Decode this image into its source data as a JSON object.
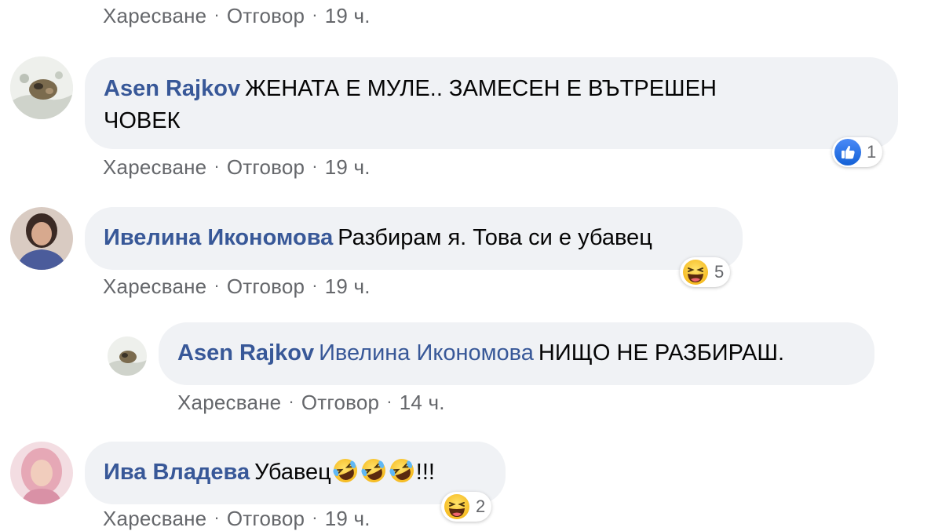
{
  "actions": {
    "like": "Харесване",
    "reply": "Отговор"
  },
  "comments": [
    {
      "time": "19 ч."
    },
    {
      "author": "Asen Rajkov",
      "line1": "ЖЕНАТА Е МУЛЕ.. ЗАМЕСЕН Е ВЪТРЕШЕН",
      "line2": "ЧОВЕК",
      "time": "19 ч.",
      "reaction": {
        "icon": "thumbs-up-icon",
        "count": "1"
      }
    },
    {
      "author": "Ивелина Икономова",
      "text": "Разбирам я. Това си е убавец",
      "time": "19 ч.",
      "reaction": {
        "icon": "laughing-emoji-icon",
        "count": "5"
      }
    },
    {
      "author": "Asen Rajkov",
      "mention": "Ивелина Икономова",
      "text": "НИЩО НЕ РАЗБИРАШ.",
      "time": "14 ч."
    },
    {
      "author": "Ива Владева",
      "text_before": "Убавец",
      "text_after": "!!!",
      "inline_emoji": [
        "rolling-laughing-emoji-icon",
        "rolling-laughing-emoji-icon",
        "rolling-laughing-emoji-icon"
      ],
      "time": "19 ч.",
      "reaction": {
        "icon": "laughing-emoji-icon",
        "count": "2"
      }
    }
  ],
  "colors": {
    "author": "#385898",
    "meta": "#65676b",
    "bubble": "#f0f2f5",
    "like_blue": "#1877f2",
    "emoji_yellow": "#ffd44a"
  }
}
